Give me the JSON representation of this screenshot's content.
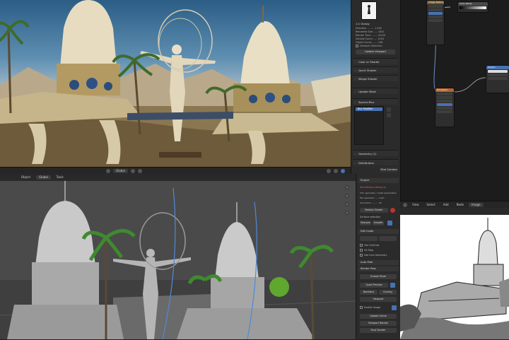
{
  "render_view": {
    "name": "Rendered viewport — fantasy temple with statue",
    "header_mode": "Global"
  },
  "props_top": {
    "object_name": "1:1 Glossy",
    "rows": [
      "Direction ......... 1.000",
      "Rendered Size ..... 1920",
      "Render Time ........ 00:00",
      "Sample Count ..... 1024",
      "Object Count ....... 148"
    ],
    "checkbox_label": "Viewport Selection",
    "apply_button": "Update Viewport",
    "sections": [
      "Color or Shader",
      "Quick Shader",
      "Merge Shader",
      "Update Mesh"
    ],
    "list_header": "Special Blur",
    "list_selected": "Blur Modifier",
    "bottom_sections": [
      "Geometry (1)",
      "Distribution"
    ],
    "footer_button": "Shut Camera"
  },
  "node_editor": {
    "header_items": [
      "View",
      "Select",
      "Add",
      "Node",
      "Image"
    ],
    "nodes": [
      "Image Texture",
      "Color Ramp",
      "Principled",
      "Output"
    ]
  },
  "work_view": {
    "header_items": [
      "Object",
      "Global",
      "Tools"
    ]
  },
  "plugin": {
    "title": "Engine",
    "warning": "Something missing is...",
    "info_rows": [
      "Info: geometry / mesh parameters",
      "File resolution  ..... Auto",
      "Use frame .......... 24"
    ],
    "action_button": "Relabel Shader",
    "section_label": "Surface selection",
    "options": [
      "Sharpen",
      "Smooth",
      "Flat"
    ],
    "subsection": "Edit mode",
    "checkboxes": [
      "Use Outlines",
      "Gh Map",
      "Use Line Geometry"
    ],
    "tools_header": "Auto Path",
    "render_panel": "Render Pass",
    "render_button": "Enable Panel",
    "sub_buttons": [
      "Quad Preview",
      "Backface",
      "Overlay",
      "Viewport"
    ],
    "enable_label": "Enable Image",
    "final_buttons": [
      "Update Scene",
      "Viewport Render",
      "Final Render"
    ]
  },
  "colors": {
    "accent_blue": "#4772b3",
    "panel_bg": "#2b2b2b",
    "viewport_gray": "#4a4a4a",
    "warning_red": "#b33333"
  }
}
